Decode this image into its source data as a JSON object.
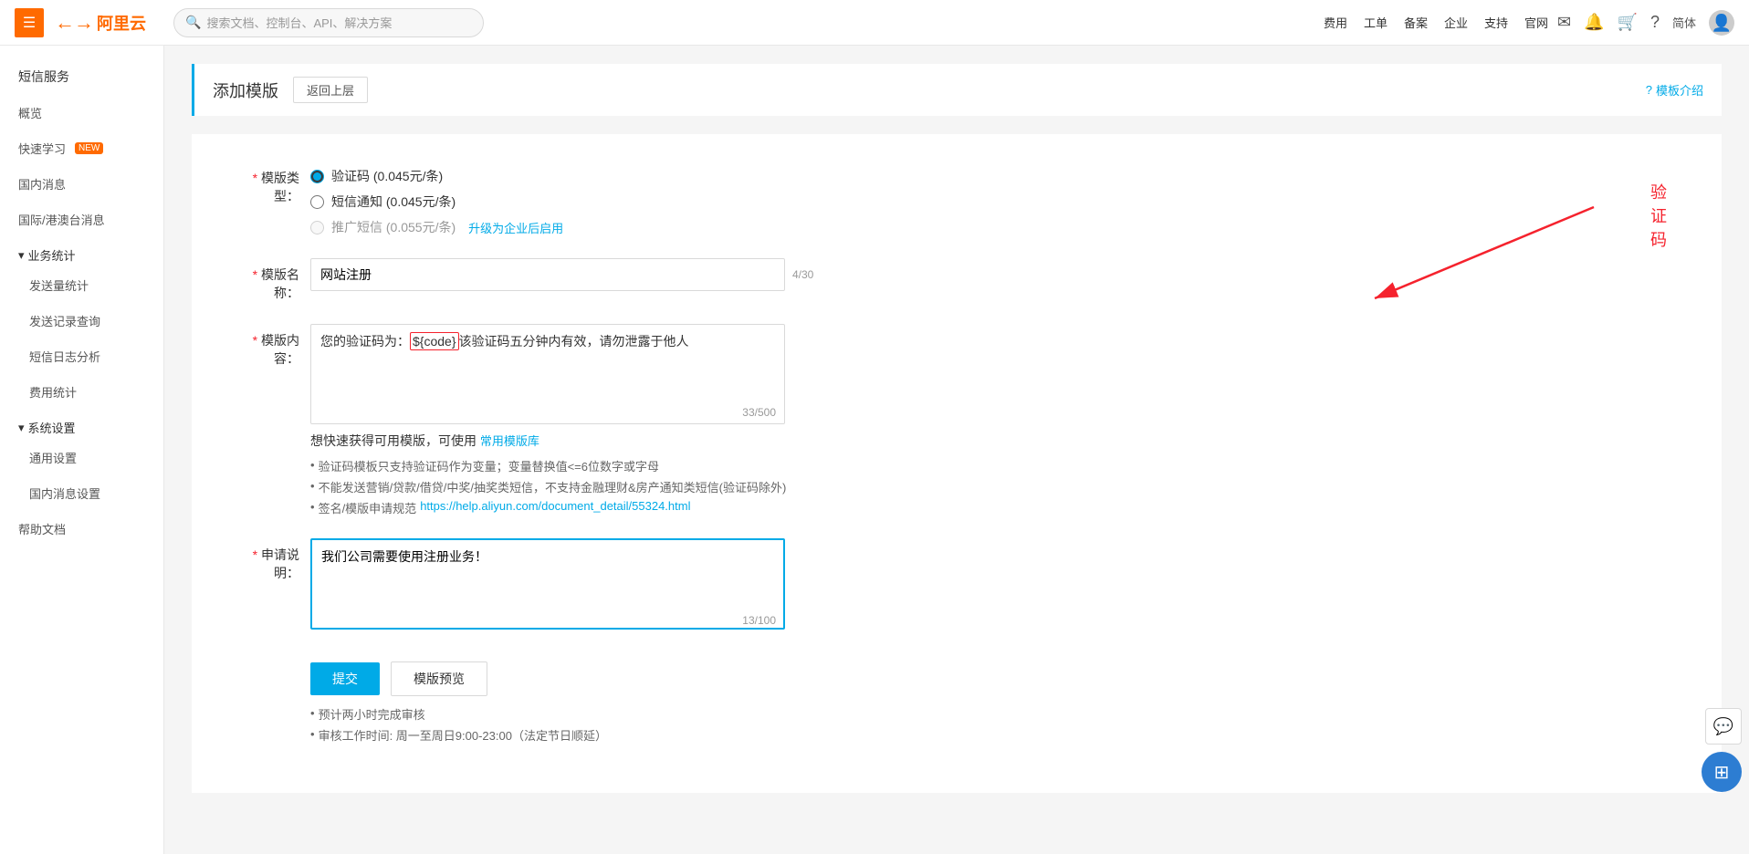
{
  "topnav": {
    "hamburger_label": "☰",
    "logo_icon": "←→",
    "logo_text": "阿里云",
    "search_placeholder": "搜索文档、控制台、API、解决方案",
    "nav_items": [
      "费用",
      "工单",
      "备案",
      "企业",
      "支持",
      "官网"
    ],
    "lang": "简体"
  },
  "sidebar": {
    "title": "短信服务",
    "items": [
      {
        "id": "overview",
        "label": "概览"
      },
      {
        "id": "quicklearn",
        "label": "快速学习",
        "badge": "NEW"
      },
      {
        "id": "domestic",
        "label": "国内消息"
      },
      {
        "id": "intl",
        "label": "国际/港澳台消息"
      },
      {
        "id": "biz-stats",
        "label": "业务统计",
        "section": true
      },
      {
        "id": "send-stats",
        "label": "发送量统计"
      },
      {
        "id": "send-log",
        "label": "发送记录查询"
      },
      {
        "id": "sms-log",
        "label": "短信日志分析"
      },
      {
        "id": "cost-stats",
        "label": "费用统计"
      },
      {
        "id": "sys-settings",
        "label": "系统设置",
        "section": true
      },
      {
        "id": "general-settings",
        "label": "通用设置"
      },
      {
        "id": "domestic-settings",
        "label": "国内消息设置"
      },
      {
        "id": "help",
        "label": "帮助文档"
      }
    ]
  },
  "page": {
    "title": "添加模版",
    "back_label": "返回上层",
    "intro_label": "模板介绍"
  },
  "form": {
    "template_type_label": "模版类型",
    "template_type_options": [
      {
        "value": "verify",
        "label": "验证码 (0.045元/条)",
        "checked": true
      },
      {
        "value": "notify",
        "label": "短信通知 (0.045元/条)",
        "checked": false
      },
      {
        "value": "promo",
        "label": "推广短信 (0.055元/条)",
        "checked": false
      }
    ],
    "upgrade_link": "升级为企业后启用",
    "name_label": "模版名称",
    "name_value": "网站注册",
    "name_count": "4/30",
    "content_label": "模版内容",
    "content_prefix": "您的验证码为：",
    "content_variable": "${code}",
    "content_suffix": "该验证码五分钟内有效，请勿泄露于他人",
    "content_count": "33/500",
    "template_lib_hint": "想快速获得可用模版，可使用",
    "template_lib_link": "常用模版库",
    "hints": [
      "验证码模板只支持验证码作为变量；变量替换值<=6位数字或字母",
      "不能发送营销/贷款/借贷/中奖/抽奖类短信，不支持金融理财&房产通知类短信(验证码除外)",
      "签名/模版申请规范 https://help.aliyun.com/document_detail/55324.html"
    ],
    "hints_link": "https://help.aliyun.com/document_detail/55324.html",
    "apply_label": "申请说明",
    "apply_value": "我们公司需要使用注册业务！",
    "apply_count": "13/100",
    "submit_label": "提交",
    "preview_label": "模版预览",
    "submit_hints": [
      "预计两小时完成审核",
      "审核工作时间: 周一至周日9:00-23:00（法定节日顺延）"
    ]
  },
  "annotation": {
    "text": "验证码"
  },
  "float": {
    "chat_icon": "💬",
    "grid_icon": "⊞"
  }
}
